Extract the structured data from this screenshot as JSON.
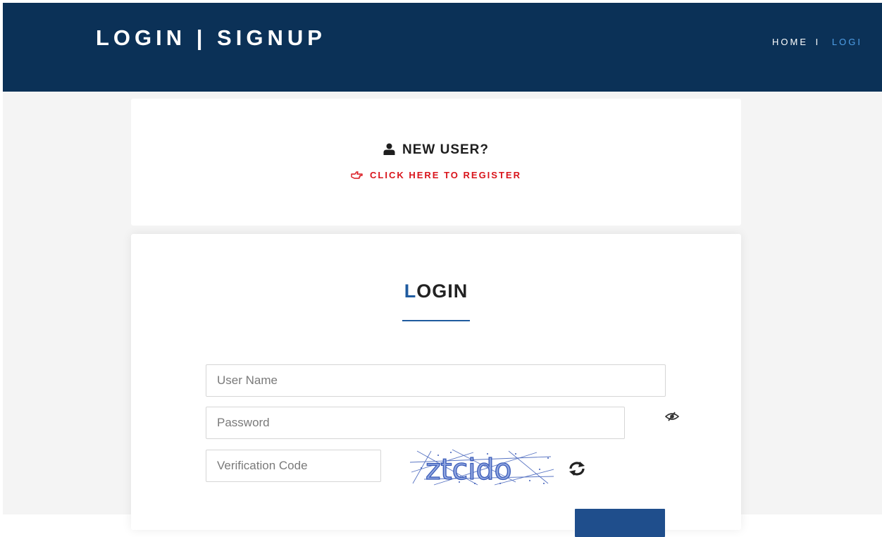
{
  "header": {
    "title": "LOGIN | SIGNUP",
    "breadcrumb": {
      "home": "HOME",
      "separator": "I",
      "current": "LOGI"
    }
  },
  "register": {
    "heading": "NEW USER?",
    "link_label": "CLICK HERE TO REGISTER",
    "icons": [
      "user-icon",
      "hand-pointer-icon"
    ]
  },
  "login": {
    "title_first_letter": "L",
    "title_rest": "OGIN",
    "fields": {
      "username_placeholder": "User Name",
      "password_placeholder": "Password",
      "code_placeholder": "Verification Code"
    },
    "captcha_text": "ztcido",
    "icons": [
      "eye-slash-icon",
      "refresh-icon"
    ]
  },
  "colors": {
    "header_bg": "#0b3157",
    "accent": "#1f5b9f",
    "link_red": "#d9141b",
    "breadcrumb_active": "#4f9fe8",
    "page_bg": "#f4f4f4"
  }
}
